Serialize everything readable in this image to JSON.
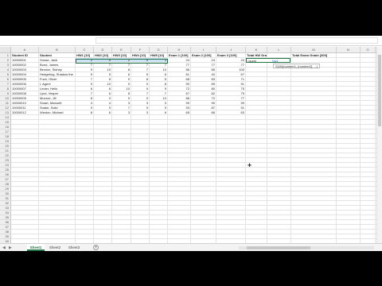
{
  "columns": [
    "A",
    "B",
    "C",
    "D",
    "E",
    "F",
    "G",
    "H",
    "I",
    "J",
    "K",
    "L",
    "M",
    "N",
    "O",
    "P"
  ],
  "headers": {
    "a": "Student ID",
    "b": "Student",
    "hw1": "HW1 [10]",
    "hw2": "HW2 [10]",
    "hw3": "HW3 [10]",
    "hw4": "HW4 [10]",
    "hw5": "HW5 [10]",
    "ex1": "Exam 1 [100]",
    "ex2": "Exam 2 [100]",
    "ex3": "Exam 3 [100]",
    "total_hw": "Total HW Grade [40]",
    "total_exam": "Total Exam Grade [300]"
  },
  "rows": [
    {
      "id": "10000001",
      "name": "Gosse, Jack",
      "hw": [
        "2",
        "4",
        "2",
        "4",
        "3"
      ],
      "ex": [
        "24",
        "24",
        "24"
      ]
    },
    {
      "id": "10000002",
      "name": "Bond, James",
      "hw": [
        "7",
        "7",
        "7",
        "7",
        "7"
      ],
      "ex": [
        "77",
        "77",
        "77"
      ]
    },
    {
      "id": "10000003",
      "name": "Binnion, Sidney",
      "hw": [
        "9",
        "10",
        "8",
        "7",
        "10"
      ],
      "ex": [
        "86",
        "85",
        "100"
      ]
    },
    {
      "id": "10000004",
      "name": "Hedgehog, Shadow the",
      "hw": [
        "5",
        "5",
        "6",
        "5",
        "6"
      ],
      "ex": [
        "61",
        "40",
        "67"
      ]
    },
    {
      "id": "10000005",
      "name": "Fuch, Oliver",
      "hw": [
        "7",
        "8",
        "9",
        "8",
        "5"
      ],
      "ex": [
        "68",
        "83",
        "71"
      ]
    },
    {
      "id": "10000006",
      "name": "I, Agent",
      "hw": [
        "9",
        "10",
        "9",
        "9",
        "8"
      ],
      "ex": [
        "90",
        "89",
        "91"
      ]
    },
    {
      "id": "10000007",
      "name": "Lecter, Hello",
      "hw": [
        "8",
        "8",
        "10",
        "9",
        "9"
      ],
      "ex": [
        "72",
        "80",
        "75"
      ]
    },
    {
      "id": "10000008",
      "name": "Lynd, Vesper",
      "hw": [
        "7",
        "6",
        "8",
        "7",
        "7"
      ],
      "ex": [
        "67",
        "82",
        "75"
      ]
    },
    {
      "id": "10000009",
      "name": "Munroe, Jill",
      "hw": [
        "8",
        "9",
        "9",
        "9",
        "10"
      ],
      "ex": [
        "88",
        "72",
        "77"
      ]
    },
    {
      "id": "10000010",
      "name": "Smart, Maxwell",
      "hw": [
        "4",
        "4",
        "3",
        "3",
        "3"
      ],
      "ex": [
        "99",
        "99",
        "99"
      ]
    },
    {
      "id": "10000011",
      "name": "Snake, Solid",
      "hw": [
        "9",
        "9",
        "7",
        "9",
        "9"
      ],
      "ex": [
        "93",
        "87",
        "91"
      ]
    },
    {
      "id": "10000012",
      "name": "Weston, Michael",
      "hw": [
        "8",
        "6",
        "3",
        "3",
        "6"
      ],
      "ex": [
        "65",
        "66",
        "63"
      ]
    }
  ],
  "editing": {
    "formula": "=sum(",
    "ref": "hw1"
  },
  "tooltip": "SUM(number1, [number2], ...)",
  "sheets": [
    "Sheet1",
    "Sheet2",
    "Sheet3"
  ],
  "active_sheet": "Sheet1",
  "accent": "#217346"
}
